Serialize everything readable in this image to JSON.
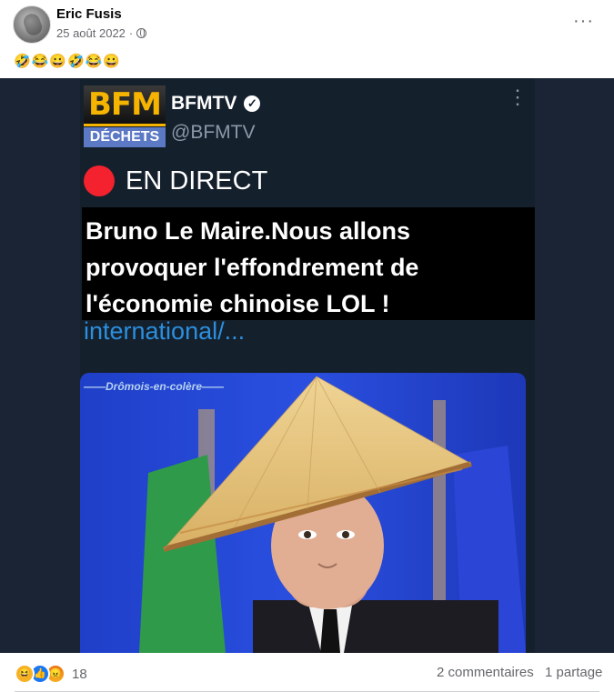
{
  "post": {
    "author": "Eric Fusis",
    "date": "25 août 2022",
    "separator": "·",
    "caption": "🤣😂😀🤣😂😀",
    "more_label": "···"
  },
  "image": {
    "bfm_logo_top": "BFM",
    "bfm_logo_bottom": "DÉCHETS",
    "channel_name": "BFMTV",
    "handle": "@BFMTV",
    "live_label": "EN DIRECT",
    "headline": "Bruno Le Maire.Nous allons provoquer l'effondrement de l'économie chinoise LOL !",
    "link_text": "international/...",
    "watermark": "——Drômois-en-colère——",
    "colors": {
      "live_red": "#f4212e",
      "bfm_yellow": "#f5b400",
      "bfm_blue": "#5b79c4",
      "link_blue": "#2b8fde"
    }
  },
  "footer": {
    "reaction_icons": [
      "haha-icon",
      "like-icon",
      "angry-icon"
    ],
    "reaction_count": "18",
    "comments": "2 commentaires",
    "shares": "1 partage"
  }
}
